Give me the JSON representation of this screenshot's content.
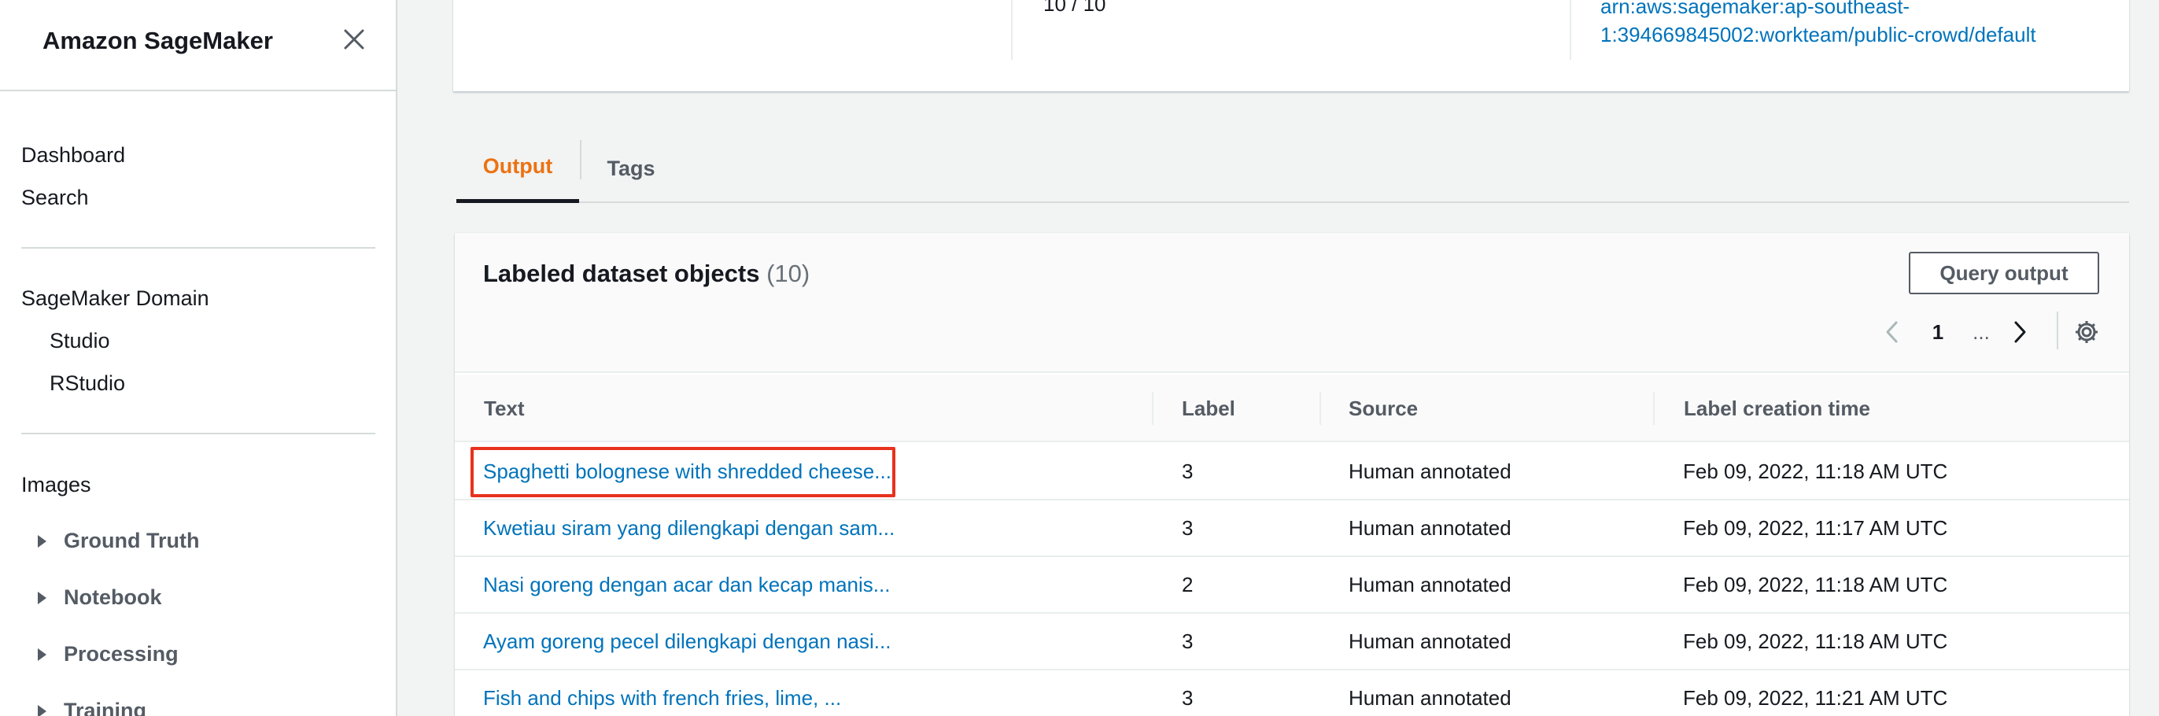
{
  "sidebar": {
    "title": "Amazon SageMaker",
    "links": [
      "Dashboard",
      "Search"
    ],
    "domain_section": "SageMaker Domain",
    "domain_items": [
      "Studio",
      "RStudio"
    ],
    "images_section": "Images",
    "groups": [
      "Ground Truth",
      "Notebook",
      "Processing",
      "Training"
    ]
  },
  "summary": {
    "objects_value": "10 / 10",
    "workteam_arn_line1": "arn:aws:sagemaker:ap-southeast-",
    "workteam_arn_line2": "1:394669845002:workteam/public-crowd/default"
  },
  "tabs": [
    {
      "label": "Output",
      "active": true
    },
    {
      "label": "Tags",
      "active": false
    }
  ],
  "table": {
    "title": "Labeled dataset objects",
    "count": "(10)",
    "query_button": "Query output",
    "pagination": {
      "current_page": "1",
      "ellipsis": "..."
    },
    "columns": [
      "Text",
      "Label",
      "Source",
      "Label creation time"
    ],
    "rows": [
      {
        "text": "Spaghetti bolognese with shredded cheese...",
        "label": "3",
        "source": "Human annotated",
        "time": "Feb 09, 2022, 11:18 AM UTC"
      },
      {
        "text": "Kwetiau siram yang dilengkapi dengan sam...",
        "label": "3",
        "source": "Human annotated",
        "time": "Feb 09, 2022, 11:17 AM UTC"
      },
      {
        "text": "Nasi goreng dengan acar dan kecap manis...",
        "label": "2",
        "source": "Human annotated",
        "time": "Feb 09, 2022, 11:18 AM UTC"
      },
      {
        "text": "Ayam goreng pecel dilengkapi dengan nasi...",
        "label": "3",
        "source": "Human annotated",
        "time": "Feb 09, 2022, 11:18 AM UTC"
      },
      {
        "text": "Fish and chips with french fries, lime, ...",
        "label": "3",
        "source": "Human annotated",
        "time": "Feb 09, 2022, 11:21 AM UTC"
      }
    ]
  },
  "icons": {
    "close": "close-icon",
    "prev": "chevron-left-icon",
    "next": "chevron-right-icon",
    "settings": "gear-icon",
    "expand": "caret-right-icon"
  },
  "colors": {
    "link": "#0073bb",
    "active_tab": "#ec7211",
    "highlight_box": "#e8321d"
  }
}
